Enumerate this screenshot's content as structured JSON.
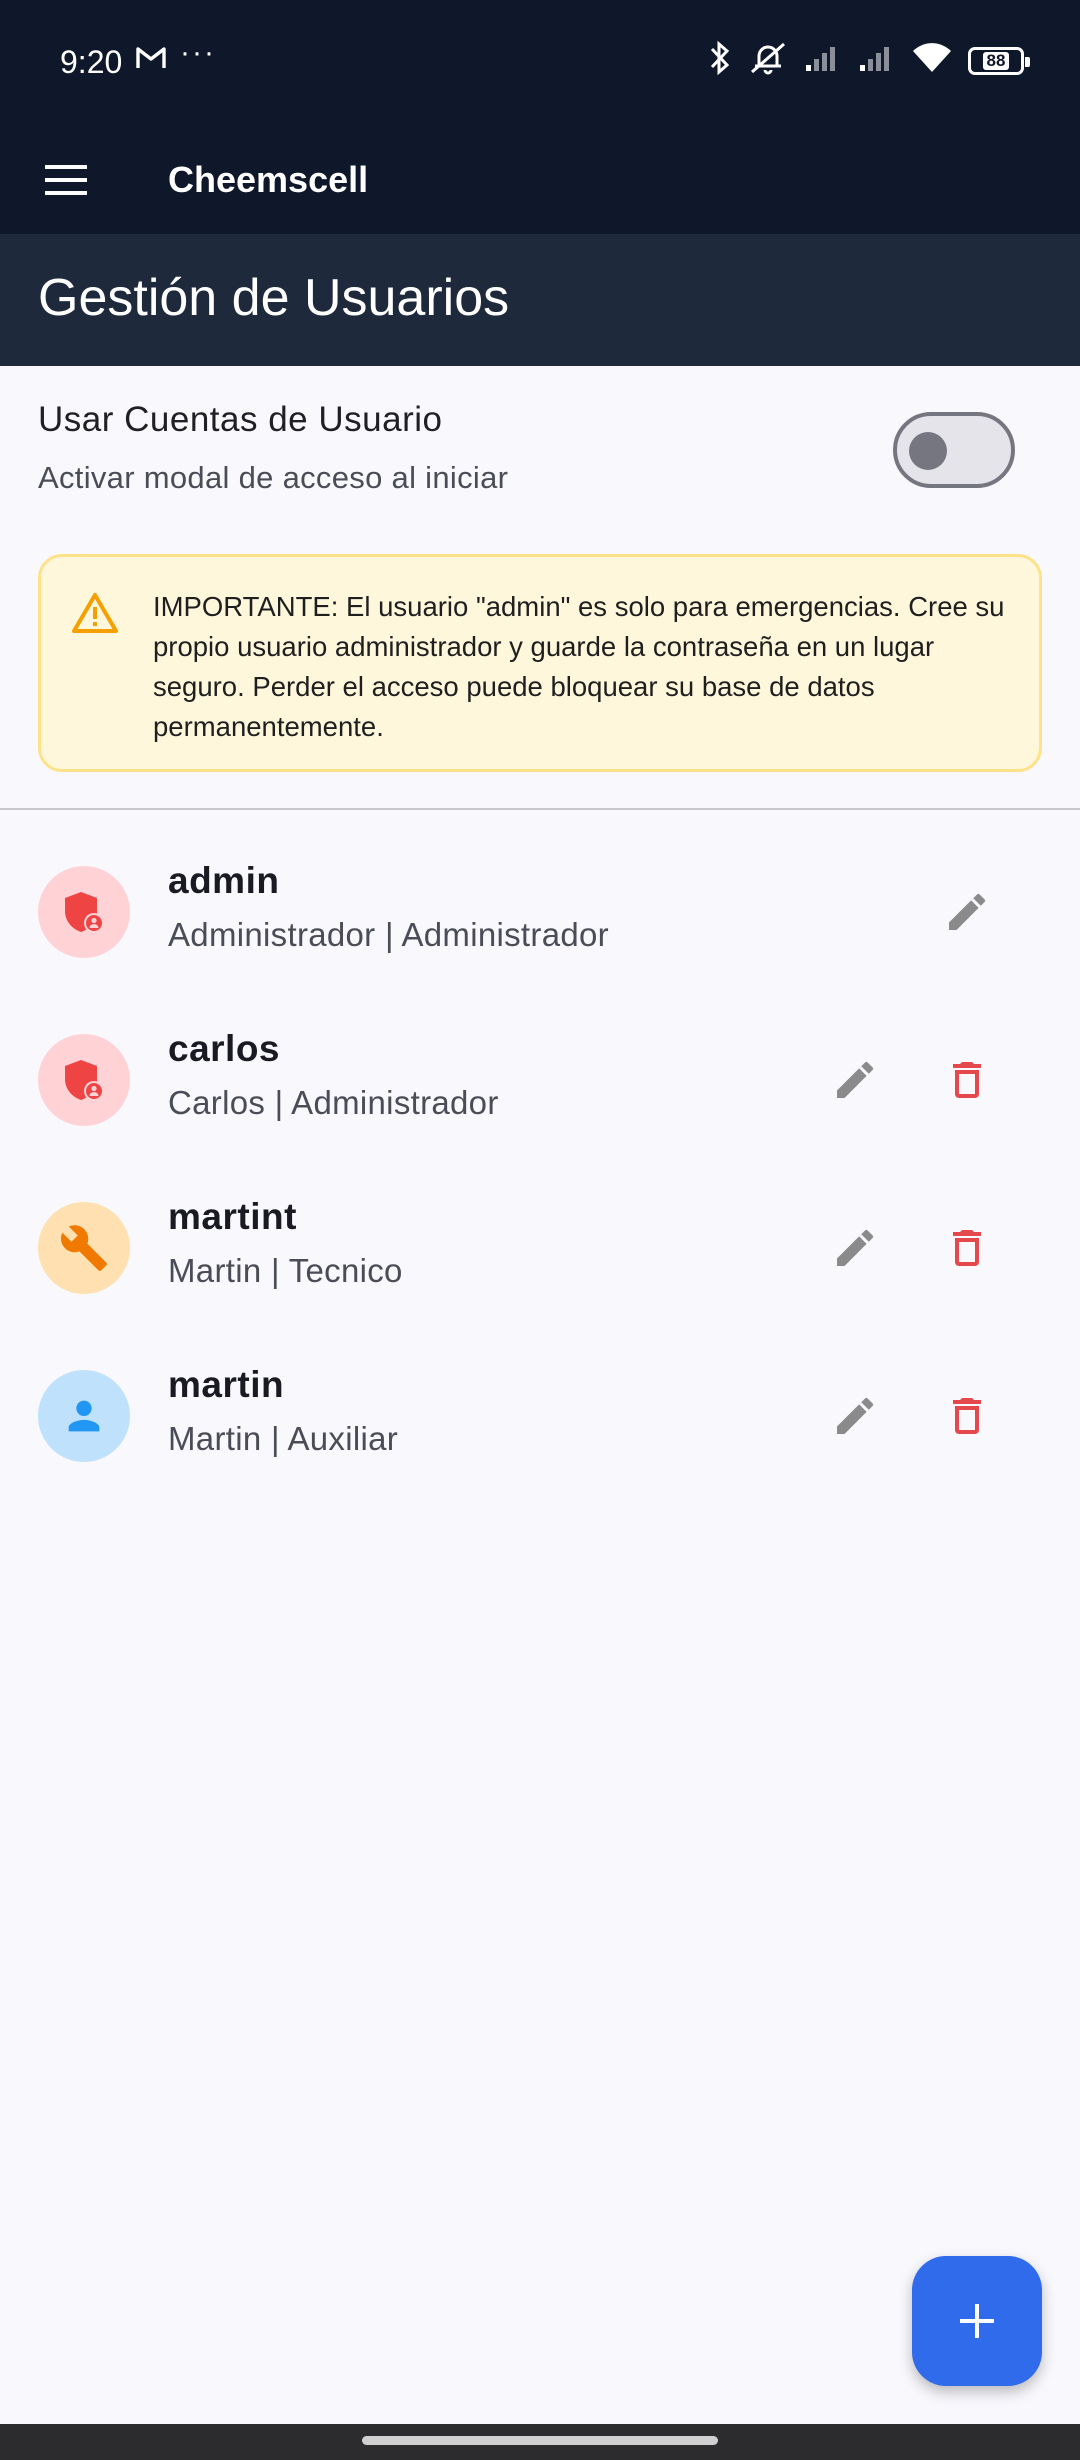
{
  "status_bar": {
    "time": "9:20",
    "more": "···",
    "battery": "88"
  },
  "app_bar": {
    "title": "Cheemscell",
    "menu_icon": "menu-icon"
  },
  "page": {
    "title": "Gestión de Usuarios"
  },
  "setting": {
    "title": "Usar Cuentas de Usuario",
    "subtitle": "Activar modal de acceso al iniciar",
    "enabled": false
  },
  "warning": {
    "icon": "warning-icon",
    "text": "IMPORTANTE: El usuario \"admin\" es solo para emergencias. Cree su propio usuario administrador y guarde la contraseña en un lugar seguro. Perder el acceso puede bloquear su base de datos permanentemente."
  },
  "users": [
    {
      "username": "admin",
      "details": "Administrador | Administrador",
      "icon": "admin-shield-icon",
      "avatar_bg": "#ffd3d6",
      "icon_color": "#ef4444",
      "can_delete": false
    },
    {
      "username": "carlos",
      "details": "Carlos | Administrador",
      "icon": "admin-shield-icon",
      "avatar_bg": "#ffd3d6",
      "icon_color": "#ef4444",
      "can_delete": true
    },
    {
      "username": "martint",
      "details": "Martin | Tecnico",
      "icon": "wrench-icon",
      "avatar_bg": "#ffe0b0",
      "icon_color": "#f07a00",
      "can_delete": true
    },
    {
      "username": "martin",
      "details": "Martin | Auxiliar",
      "icon": "person-icon",
      "avatar_bg": "#bfe1fb",
      "icon_color": "#2196f3",
      "can_delete": true
    }
  ],
  "colors": {
    "app_bar": "#0f172a",
    "header": "#1e293b",
    "edit_icon": "#8a8a8a",
    "delete_icon": "#e5484d",
    "fab": "#2f6bea"
  },
  "fab": {
    "icon": "add-icon"
  }
}
